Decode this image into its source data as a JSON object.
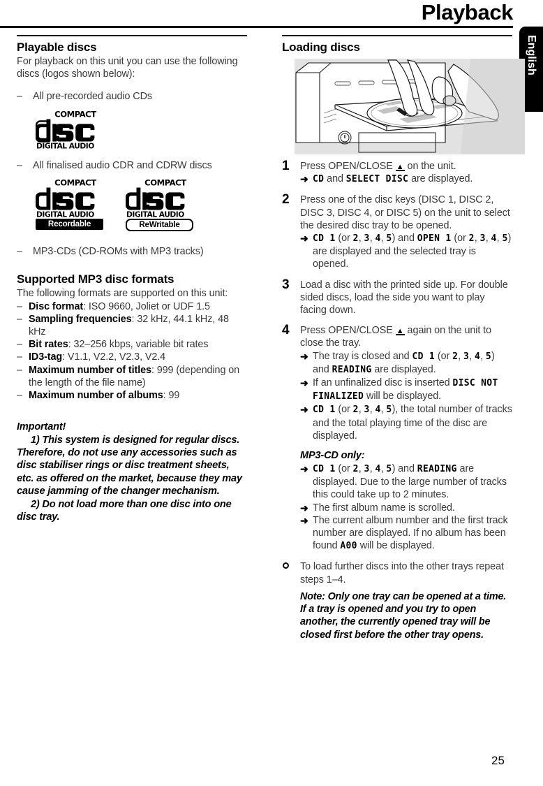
{
  "page": {
    "title": "Playback",
    "language_tab": "English",
    "page_number": "25"
  },
  "left_column": {
    "playable_discs": {
      "heading": "Playable discs",
      "intro": "For playback on this unit you can use the following discs (logos shown below):",
      "items": [
        {
          "dash": "–",
          "text": "All pre-recorded audio CDs"
        },
        {
          "dash": "–",
          "text": "All finalised audio CDR and CDRW discs"
        },
        {
          "dash": "–",
          "text": "MP3-CDs (CD-ROMs with MP3 tracks)"
        }
      ],
      "logos": [
        {
          "name": "compact-disc-digital-audio",
          "line1": "COMPACT",
          "line2": "disc",
          "line3": "DIGITAL AUDIO",
          "tag": null
        },
        {
          "name": "compact-disc-digital-audio-recordable",
          "line1": "COMPACT",
          "line2": "disc",
          "line3": "DIGITAL AUDIO",
          "tag": "Recordable"
        },
        {
          "name": "compact-disc-digital-audio-rewritable",
          "line1": "COMPACT",
          "line2": "disc",
          "line3": "DIGITAL AUDIO",
          "tag": "ReWritable"
        }
      ]
    },
    "supported_formats": {
      "heading": "Supported MP3 disc formats",
      "intro": "The following formats are supported on this unit:",
      "items": [
        {
          "label": "Disc format",
          "value": ": ISO 9660, Joliet or UDF 1.5"
        },
        {
          "label": "Sampling frequencies",
          "value": ": 32 kHz, 44.1 kHz, 48 kHz"
        },
        {
          "label": "Bit rates",
          "value": ": 32–256 kbps, variable bit rates"
        },
        {
          "label": "ID3-tag",
          "value": ": V1.1, V2.2, V2.3, V2.4"
        },
        {
          "label": "Maximum number of titles",
          "value": ": 999 (depending on the length of the file name)"
        },
        {
          "label": "Maximum number of albums",
          "value": ": 99"
        }
      ]
    },
    "important": {
      "heading": "Important!",
      "item1": "1) This system is designed for regular discs. Therefore, do not use any accessories such as disc stabiliser rings or disc treatment sheets, etc. as offered on the market, because they may cause jamming of the changer mechanism.",
      "item2": "2) Do not load more than one disc into one disc tray."
    }
  },
  "right_column": {
    "heading": "Loading discs",
    "illustration_caption": "hands loading a compact disc onto an open disc tray of a hi-fi system",
    "steps": [
      {
        "number": "1",
        "text_before": "Press OPEN/CLOSE ",
        "text_after": " on the unit.",
        "results": [
          {
            "parts": [
              {
                "type": "lcd",
                "text": "CD"
              },
              {
                "type": "plain",
                "text": " and "
              },
              {
                "type": "lcd",
                "text": "SELECT DISC"
              },
              {
                "type": "plain",
                "text": " are displayed."
              }
            ]
          }
        ]
      },
      {
        "number": "2",
        "text_before": "Press one of the disc keys (DISC 1, DISC 2, DISC 3, DISC 4, or DISC 5) on the unit to select the desired disc tray to be opened.",
        "text_after": "",
        "results": [
          {
            "parts": [
              {
                "type": "lcd",
                "text": "CD 1"
              },
              {
                "type": "plain",
                "text": " (or "
              },
              {
                "type": "lcd",
                "text": "2"
              },
              {
                "type": "plain",
                "text": ", "
              },
              {
                "type": "lcd",
                "text": "3"
              },
              {
                "type": "plain",
                "text": ", "
              },
              {
                "type": "lcd",
                "text": "4"
              },
              {
                "type": "plain",
                "text": ", "
              },
              {
                "type": "lcd",
                "text": "5"
              },
              {
                "type": "plain",
                "text": ") and "
              },
              {
                "type": "lcd",
                "text": "OPEN 1"
              },
              {
                "type": "plain",
                "text": " (or "
              },
              {
                "type": "lcd",
                "text": "2"
              },
              {
                "type": "plain",
                "text": ", "
              },
              {
                "type": "lcd",
                "text": "3"
              },
              {
                "type": "plain",
                "text": ", "
              },
              {
                "type": "lcd",
                "text": "4"
              },
              {
                "type": "plain",
                "text": ", "
              },
              {
                "type": "lcd",
                "text": "5"
              },
              {
                "type": "plain",
                "text": ") are displayed and the selected tray is opened."
              }
            ]
          }
        ]
      },
      {
        "number": "3",
        "text_before": "Load a disc with the printed side up. For double sided discs, load the side you want to play facing down.",
        "text_after": "",
        "results": []
      },
      {
        "number": "4",
        "text_before": "Press OPEN/CLOSE ",
        "text_after": " again on the unit to close the tray.",
        "results": [
          {
            "parts": [
              {
                "type": "plain",
                "text": "The tray is closed and "
              },
              {
                "type": "lcd",
                "text": "CD 1"
              },
              {
                "type": "plain",
                "text": " (or "
              },
              {
                "type": "lcd",
                "text": "2"
              },
              {
                "type": "plain",
                "text": ", "
              },
              {
                "type": "lcd",
                "text": "3"
              },
              {
                "type": "plain",
                "text": ", "
              },
              {
                "type": "lcd",
                "text": "4"
              },
              {
                "type": "plain",
                "text": ", "
              },
              {
                "type": "lcd",
                "text": "5"
              },
              {
                "type": "plain",
                "text": ") and "
              },
              {
                "type": "lcd",
                "text": "READING"
              },
              {
                "type": "plain",
                "text": " are displayed."
              }
            ]
          },
          {
            "parts": [
              {
                "type": "plain",
                "text": "If an unfinalized disc is inserted "
              },
              {
                "type": "lcd",
                "text": "DISC NOT FINALIZED"
              },
              {
                "type": "plain",
                "text": " will be displayed."
              }
            ]
          },
          {
            "parts": [
              {
                "type": "lcd",
                "text": "CD 1"
              },
              {
                "type": "plain",
                "text": " (or "
              },
              {
                "type": "lcd",
                "text": "2"
              },
              {
                "type": "plain",
                "text": ", "
              },
              {
                "type": "lcd",
                "text": "3"
              },
              {
                "type": "plain",
                "text": ", "
              },
              {
                "type": "lcd",
                "text": "4"
              },
              {
                "type": "plain",
                "text": ", "
              },
              {
                "type": "lcd",
                "text": "5"
              },
              {
                "type": "plain",
                "text": "), the total number of tracks and the total playing time of the disc are displayed."
              }
            ]
          }
        ]
      }
    ],
    "mp3_only": {
      "heading": "MP3-CD only:",
      "results": [
        {
          "parts": [
            {
              "type": "lcd",
              "text": "CD 1"
            },
            {
              "type": "plain",
              "text": " (or "
            },
            {
              "type": "lcd",
              "text": "2"
            },
            {
              "type": "plain",
              "text": ", "
            },
            {
              "type": "lcd",
              "text": "3"
            },
            {
              "type": "plain",
              "text": ", "
            },
            {
              "type": "lcd",
              "text": "4"
            },
            {
              "type": "plain",
              "text": ", "
            },
            {
              "type": "lcd",
              "text": "5"
            },
            {
              "type": "plain",
              "text": ") and "
            },
            {
              "type": "lcd",
              "text": "READING"
            },
            {
              "type": "plain",
              "text": " are displayed. Due to the large number of tracks this could take up to 2 minutes."
            }
          ]
        },
        {
          "parts": [
            {
              "type": "plain",
              "text": "The first album name is scrolled."
            }
          ]
        },
        {
          "parts": [
            {
              "type": "plain",
              "text": "The current album number and the first track number are displayed. If no album has been found "
            },
            {
              "type": "lcd",
              "text": "A00"
            },
            {
              "type": "plain",
              "text": " will be displayed."
            }
          ]
        }
      ]
    },
    "final_step": {
      "bullet": "circle",
      "text": "To load further discs into the other trays repeat steps 1–4.",
      "note": "Note: Only one tray can be opened at a time. If a tray is opened and you try to open another, the currently opened tray will be closed first before the other tray opens."
    }
  },
  "icons": {
    "eject": "eject-icon",
    "arrow": "➜",
    "dash": "–"
  },
  "colors": {
    "text_body": "#3a3a3a",
    "text_bold": "#000000",
    "illustration_bg": "#e2e2e2",
    "tab_bg": "#000000",
    "tab_text": "#ffffff"
  }
}
